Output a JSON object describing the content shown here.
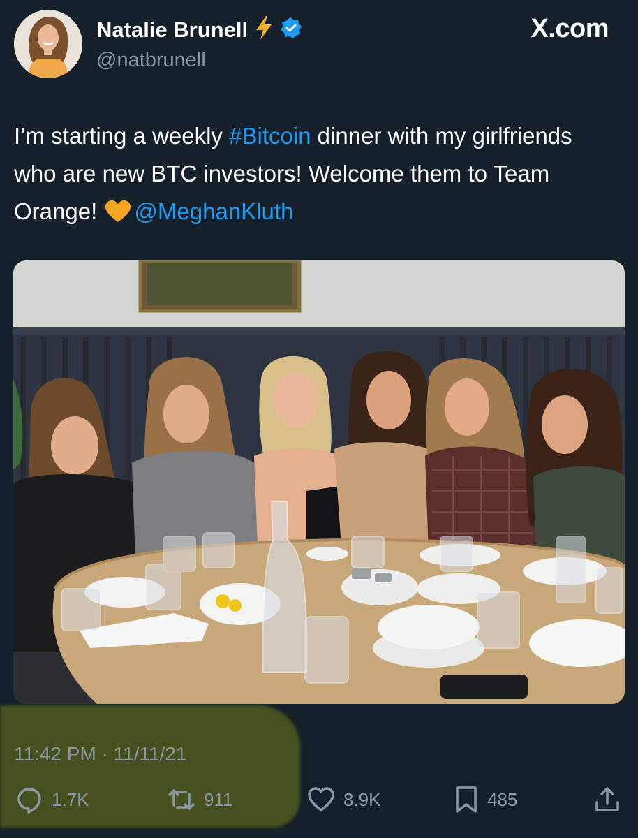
{
  "author": {
    "display_name": "Natalie Brunell",
    "handle": "@natbrunell",
    "badge_emoji": "lightning-bolt-icon",
    "verified": true
  },
  "source": "X.com",
  "tweet": {
    "text_part1": "I’m starting a weekly ",
    "hashtag": "#Bitcoin",
    "text_part2": " dinner with my girlfriends who are new BTC investors! Welcome them to Team Orange! ",
    "mention": "@MeghanKluth"
  },
  "timestamp": "11:42 PM · 11/11/21",
  "stats": {
    "replies": "1.7K",
    "retweets": "911",
    "likes": "8.9K",
    "bookmarks": "485"
  },
  "colors": {
    "background": "#15202b",
    "link": "#1d9bf0",
    "muted": "#8b98a5",
    "highlight": "#6e7814",
    "heart": "#f5a623"
  }
}
